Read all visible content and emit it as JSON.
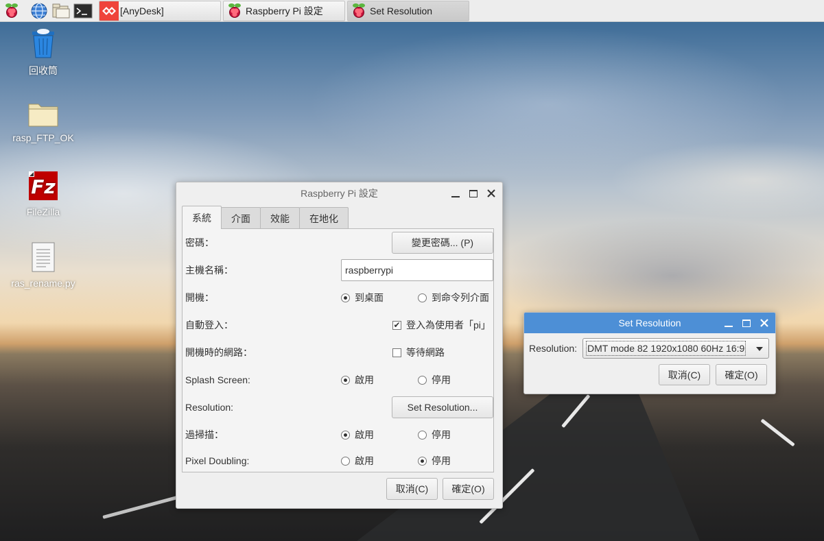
{
  "taskbar": {
    "tasks": [
      {
        "label": "[AnyDesk]",
        "icon": "anydesk-icon"
      },
      {
        "label": "Raspberry Pi 設定",
        "icon": "raspberry-icon"
      },
      {
        "label": "Set Resolution",
        "icon": "raspberry-icon"
      }
    ]
  },
  "desktop": {
    "icons": [
      {
        "label": "回收筒",
        "icon": "trash-icon"
      },
      {
        "label": "rasp_FTP_OK",
        "icon": "folder-icon"
      },
      {
        "label": "FileZilla",
        "icon": "filezilla-icon"
      },
      {
        "label": "ras_rename.py",
        "icon": "text-file-icon"
      }
    ]
  },
  "settings": {
    "title": "Raspberry Pi 設定",
    "tabs": [
      "系統",
      "介面",
      "效能",
      "在地化"
    ],
    "password_label": "密碼：",
    "change_password_button": "變更密碼... (P)",
    "hostname_label": "主機名稱：",
    "hostname_value": "raspberrypi",
    "boot_label": "開機：",
    "boot_desktop": "到桌面",
    "boot_cli": "到命令列介面",
    "autologin_label": "自動登入：",
    "autologin_option": "登入為使用者「pi」",
    "network_label": "開機時的網路：",
    "network_option": "等待網路",
    "splash_label": "Splash Screen:",
    "resolution_label": "Resolution:",
    "set_resolution_button": "Set Resolution...",
    "overscan_label": "過掃描：",
    "pixel_doubling_label": "Pixel Doubling:",
    "enable": "啟用",
    "disable": "停用",
    "cancel_button": "取消(C)",
    "ok_button": "確定(O)"
  },
  "resolution_dialog": {
    "title": "Set Resolution",
    "label": "Resolution:",
    "selected": "DMT mode 82 1920x1080 60Hz 16:9",
    "cancel_button": "取消(C)",
    "ok_button": "確定(O)"
  },
  "colors": {
    "dialog_titlebar": "#4d8fd6",
    "taskbar": "#ededed"
  }
}
